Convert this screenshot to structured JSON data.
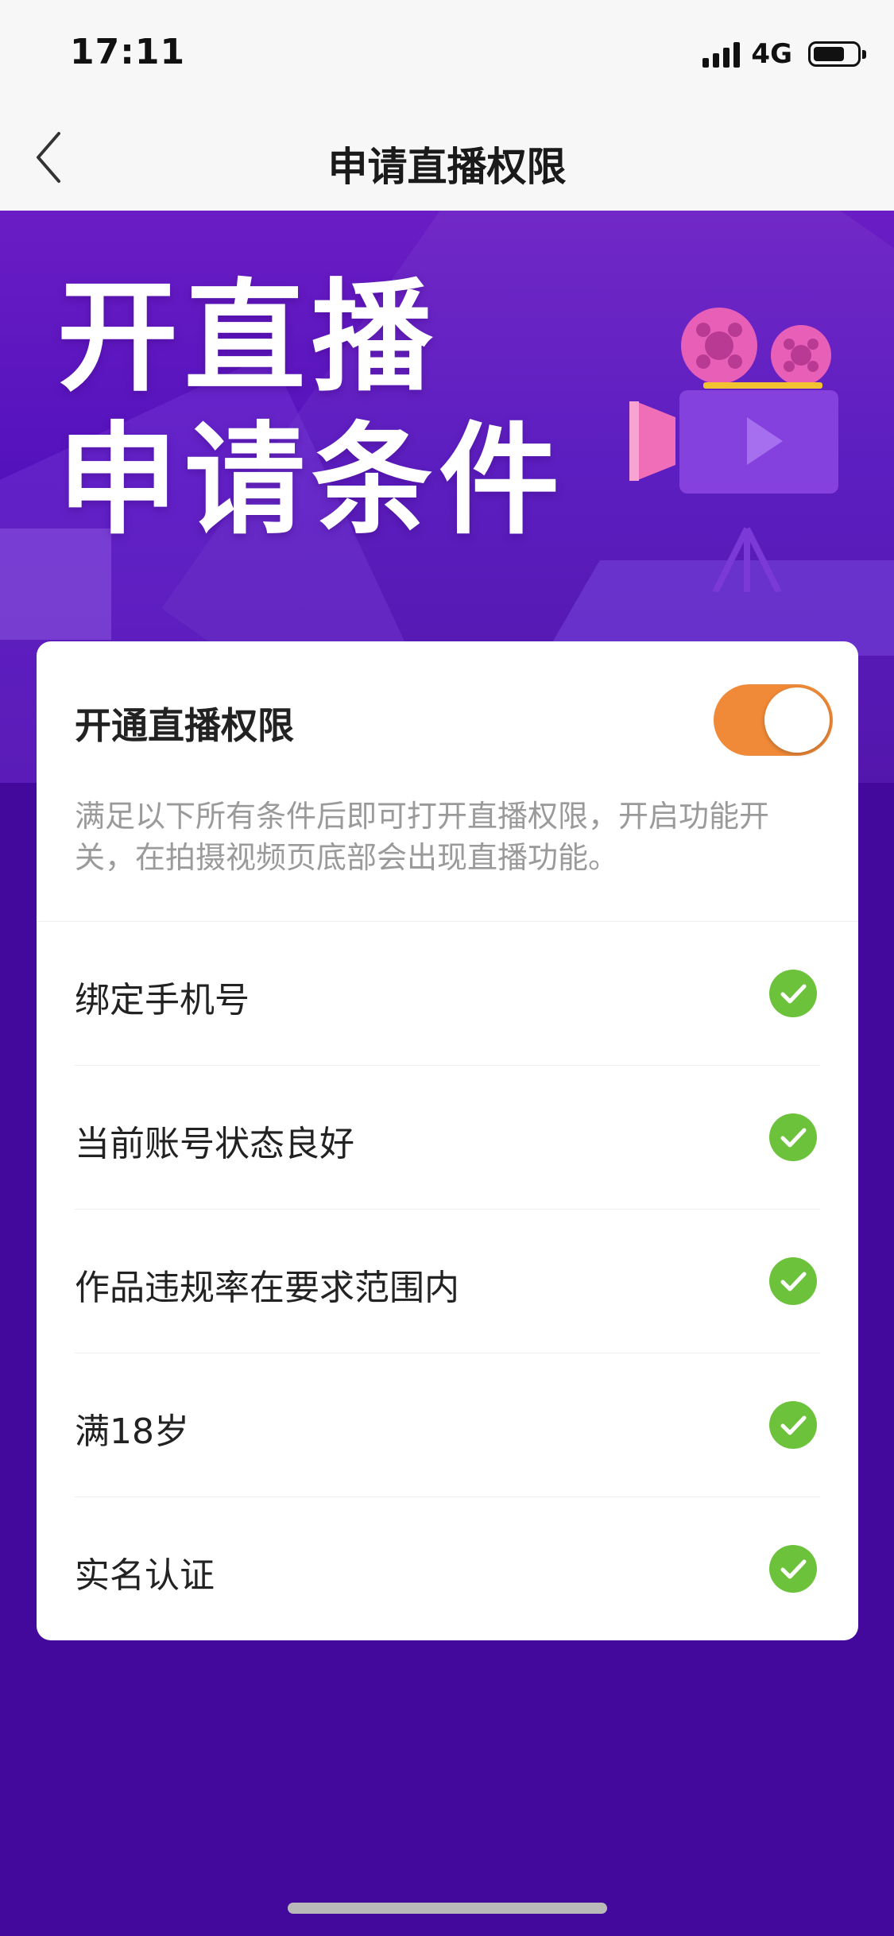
{
  "status_bar": {
    "time": "17:11",
    "network": "4G",
    "signal_bars": 4,
    "battery_level": 0.7
  },
  "nav": {
    "title": "申请直播权限",
    "back_icon": "chevron-left-icon"
  },
  "banner": {
    "line1": "开直播",
    "line2": "申请条件",
    "camera_icon": "movie-camera-icon"
  },
  "card": {
    "toggle_label": "开通直播权限",
    "toggle_on": true,
    "toggle_color": "#f08a38",
    "description": "满足以下所有条件后即可打开直播权限，开启功能开关，在拍摄视频页底部会出现直播功能。",
    "check_color": "#6cc33b",
    "requirements": [
      {
        "label": "绑定手机号",
        "met": true
      },
      {
        "label": "当前账号状态良好",
        "met": true
      },
      {
        "label": "作品违规率在要求范围内",
        "met": true
      },
      {
        "label": "满18岁",
        "met": true
      },
      {
        "label": "实名认证",
        "met": true
      }
    ]
  },
  "theme": {
    "background": "#43089c",
    "banner": "#5a14c0"
  }
}
